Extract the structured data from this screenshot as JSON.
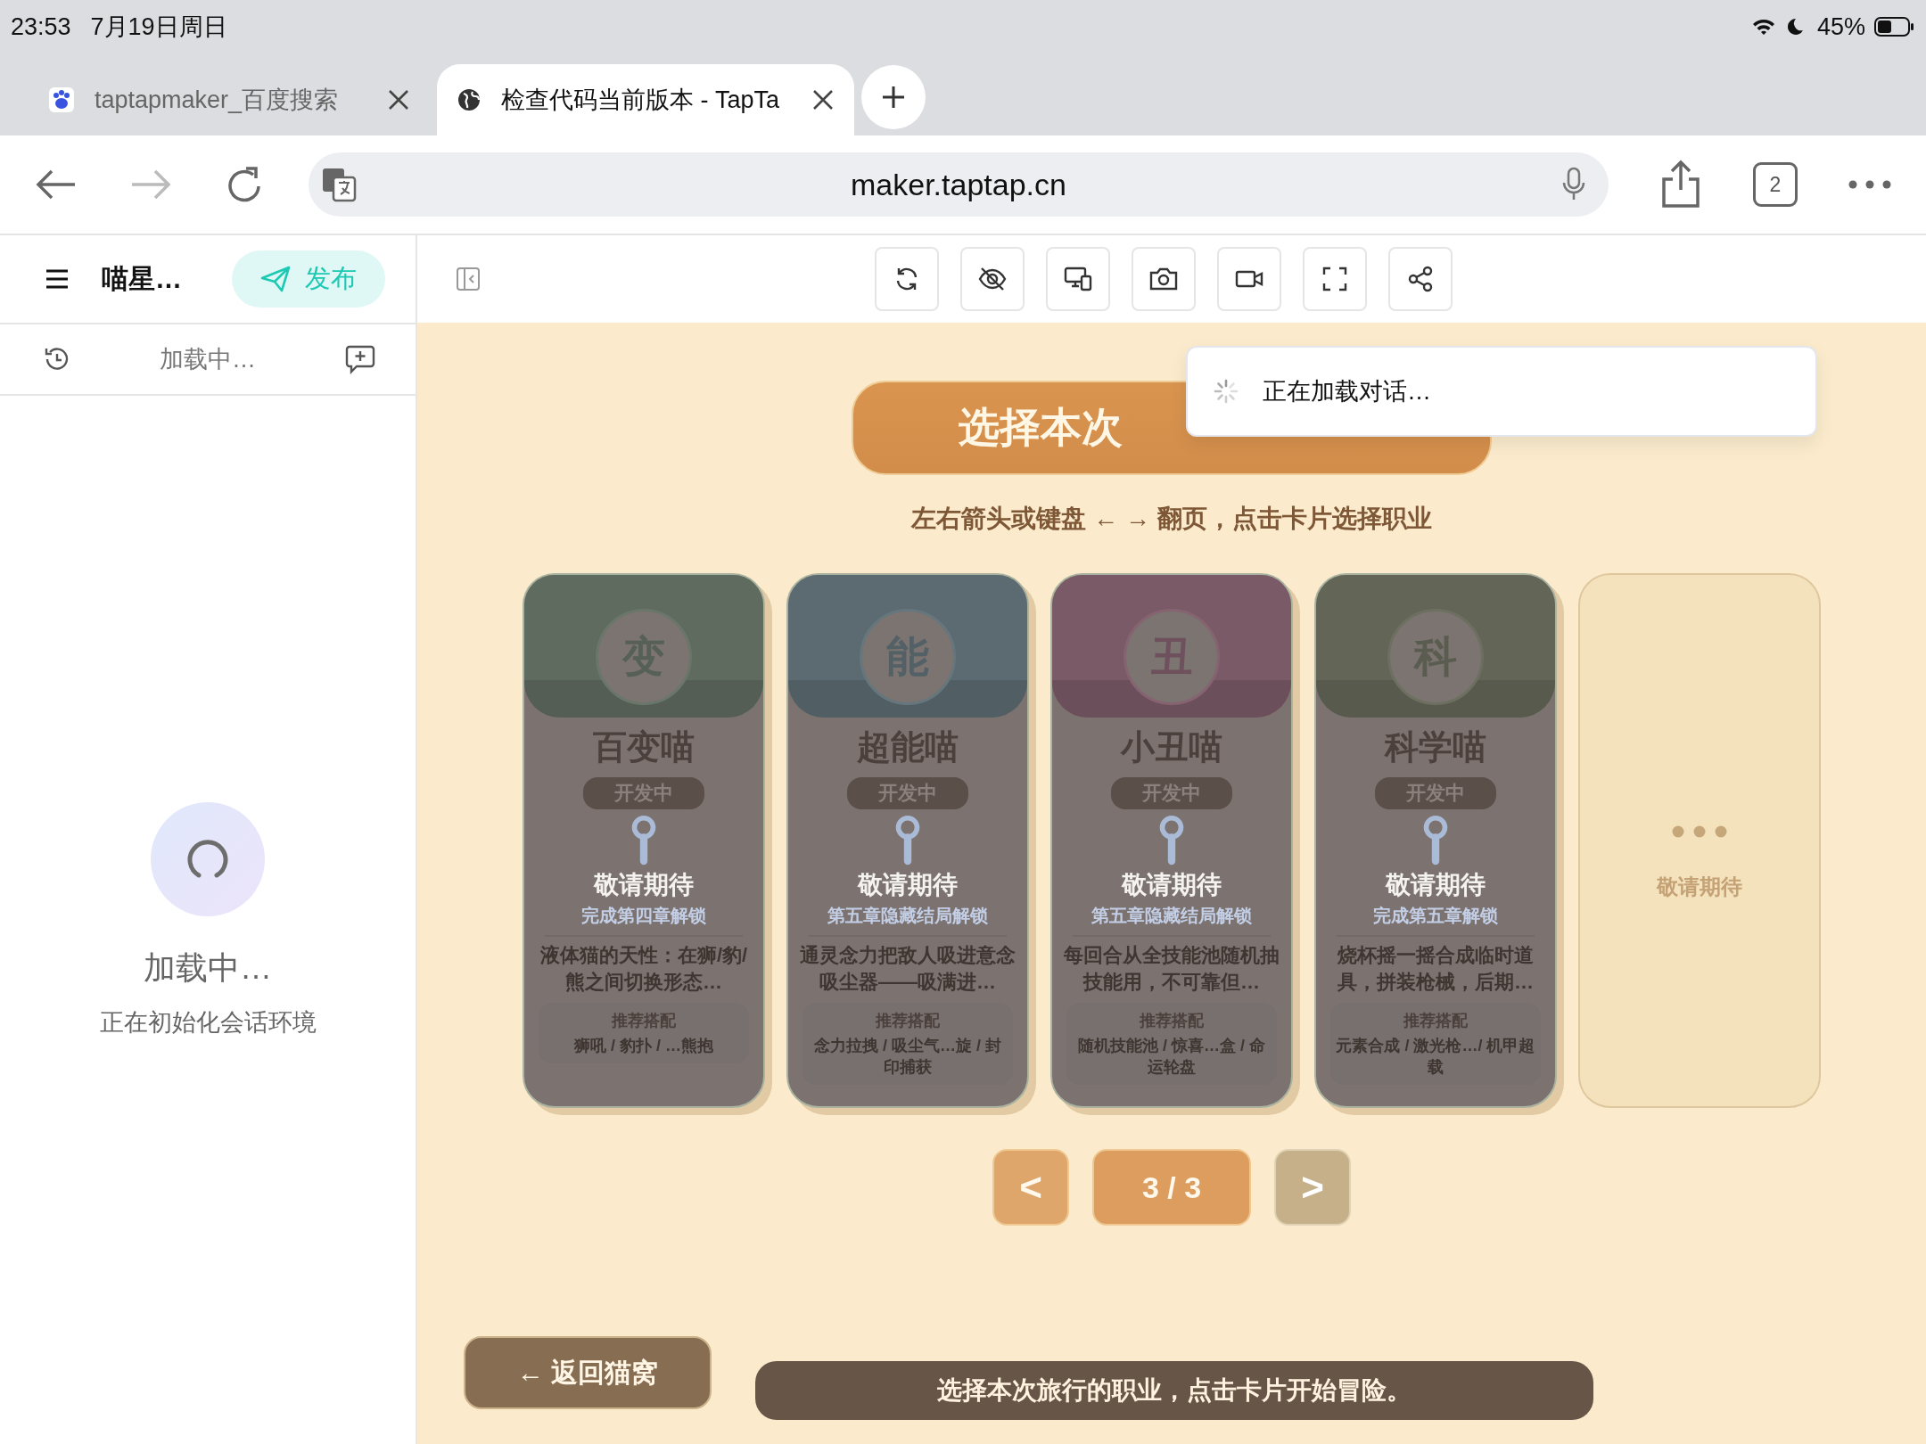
{
  "status_bar": {
    "time": "23:53",
    "date": "7月19日周日",
    "battery": "45%"
  },
  "tabs": [
    {
      "label": "taptapmaker_百度搜索",
      "selected": false
    },
    {
      "label": "检查代码当前版本 - TapTa",
      "selected": true
    }
  ],
  "address_bar": {
    "url": "maker.taptap.cn"
  },
  "tab_count": "2",
  "sidebar": {
    "title": "喵星…",
    "publish": "发布",
    "session": "加载中…",
    "loading_title": "加载中…",
    "loading_text": "正在初始化会话环境"
  },
  "toast": "正在加载对话…",
  "stage": {
    "banner": "选择本次",
    "hint": "左右箭头或键盘 ← → 翻页，点击卡片选择职业",
    "cards": [
      {
        "kind": "job",
        "avatar": "变",
        "color": "#5f6b5f",
        "name": "百变喵",
        "badge": "开发中",
        "description": "液体猫的天性：在狮/豹/熊之间切换形态…",
        "locked": true,
        "lock_label": "敬请期待",
        "unlock": "完成第四章解锁",
        "rec_title": "推荐搭配",
        "rec": "狮吼 / 豹扑 / …熊抱"
      },
      {
        "kind": "job",
        "avatar": "能",
        "color": "#5c6b71",
        "name": "超能喵",
        "badge": "开发中",
        "description": "通灵念力把敌人吸进意念吸尘器——吸满进…",
        "locked": true,
        "lock_label": "敬请期待",
        "unlock": "第五章隐藏结局解锁",
        "rec_title": "推荐搭配",
        "rec": "念力拉拽 / 吸尘气…旋 / 封印捕获"
      },
      {
        "kind": "job",
        "avatar": "丑",
        "color": "#7a5a66",
        "name": "小丑喵",
        "badge": "开发中",
        "description": "每回合从全技能池随机抽技能用，不可靠但…",
        "locked": true,
        "lock_label": "敬请期待",
        "unlock": "第五章隐藏结局解锁",
        "rec_title": "推荐搭配",
        "rec": "随机技能池 / 惊喜…盒 / 命运轮盘"
      },
      {
        "kind": "job",
        "avatar": "科",
        "color": "#636657",
        "name": "科学喵",
        "badge": "开发中",
        "description": "烧杯摇一摇合成临时道具，拼装枪械，后期…",
        "locked": true,
        "lock_label": "敬请期待",
        "unlock": "完成第五章解锁",
        "rec_title": "推荐搭配",
        "rec": "元素合成 / 激光枪…/ 机甲超载"
      },
      {
        "kind": "placeholder",
        "label": "敬请期待"
      }
    ],
    "pager": {
      "prev": "<",
      "page": "3 / 3",
      "next": ">",
      "prev_disabled": false,
      "next_disabled": true
    },
    "back_button": "← 返回猫窝",
    "footer": "选择本次旅行的职业，点击卡片开始冒险。"
  }
}
